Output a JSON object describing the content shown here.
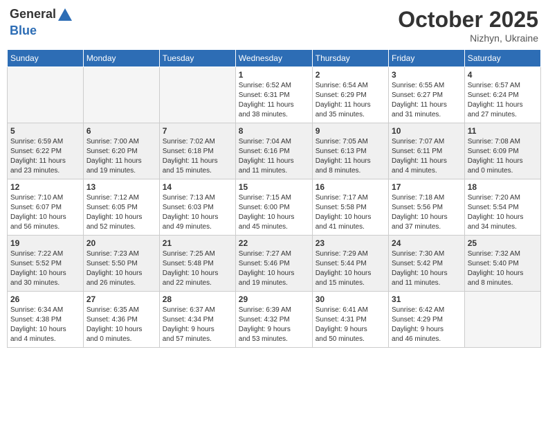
{
  "header": {
    "logo_line1": "General",
    "logo_line2": "Blue",
    "month": "October 2025",
    "location": "Nizhyn, Ukraine"
  },
  "weekdays": [
    "Sunday",
    "Monday",
    "Tuesday",
    "Wednesday",
    "Thursday",
    "Friday",
    "Saturday"
  ],
  "weeks": [
    [
      {
        "day": "",
        "info": ""
      },
      {
        "day": "",
        "info": ""
      },
      {
        "day": "",
        "info": ""
      },
      {
        "day": "1",
        "info": "Sunrise: 6:52 AM\nSunset: 6:31 PM\nDaylight: 11 hours\nand 38 minutes."
      },
      {
        "day": "2",
        "info": "Sunrise: 6:54 AM\nSunset: 6:29 PM\nDaylight: 11 hours\nand 35 minutes."
      },
      {
        "day": "3",
        "info": "Sunrise: 6:55 AM\nSunset: 6:27 PM\nDaylight: 11 hours\nand 31 minutes."
      },
      {
        "day": "4",
        "info": "Sunrise: 6:57 AM\nSunset: 6:24 PM\nDaylight: 11 hours\nand 27 minutes."
      }
    ],
    [
      {
        "day": "5",
        "info": "Sunrise: 6:59 AM\nSunset: 6:22 PM\nDaylight: 11 hours\nand 23 minutes."
      },
      {
        "day": "6",
        "info": "Sunrise: 7:00 AM\nSunset: 6:20 PM\nDaylight: 11 hours\nand 19 minutes."
      },
      {
        "day": "7",
        "info": "Sunrise: 7:02 AM\nSunset: 6:18 PM\nDaylight: 11 hours\nand 15 minutes."
      },
      {
        "day": "8",
        "info": "Sunrise: 7:04 AM\nSunset: 6:16 PM\nDaylight: 11 hours\nand 11 minutes."
      },
      {
        "day": "9",
        "info": "Sunrise: 7:05 AM\nSunset: 6:13 PM\nDaylight: 11 hours\nand 8 minutes."
      },
      {
        "day": "10",
        "info": "Sunrise: 7:07 AM\nSunset: 6:11 PM\nDaylight: 11 hours\nand 4 minutes."
      },
      {
        "day": "11",
        "info": "Sunrise: 7:08 AM\nSunset: 6:09 PM\nDaylight: 11 hours\nand 0 minutes."
      }
    ],
    [
      {
        "day": "12",
        "info": "Sunrise: 7:10 AM\nSunset: 6:07 PM\nDaylight: 10 hours\nand 56 minutes."
      },
      {
        "day": "13",
        "info": "Sunrise: 7:12 AM\nSunset: 6:05 PM\nDaylight: 10 hours\nand 52 minutes."
      },
      {
        "day": "14",
        "info": "Sunrise: 7:13 AM\nSunset: 6:03 PM\nDaylight: 10 hours\nand 49 minutes."
      },
      {
        "day": "15",
        "info": "Sunrise: 7:15 AM\nSunset: 6:00 PM\nDaylight: 10 hours\nand 45 minutes."
      },
      {
        "day": "16",
        "info": "Sunrise: 7:17 AM\nSunset: 5:58 PM\nDaylight: 10 hours\nand 41 minutes."
      },
      {
        "day": "17",
        "info": "Sunrise: 7:18 AM\nSunset: 5:56 PM\nDaylight: 10 hours\nand 37 minutes."
      },
      {
        "day": "18",
        "info": "Sunrise: 7:20 AM\nSunset: 5:54 PM\nDaylight: 10 hours\nand 34 minutes."
      }
    ],
    [
      {
        "day": "19",
        "info": "Sunrise: 7:22 AM\nSunset: 5:52 PM\nDaylight: 10 hours\nand 30 minutes."
      },
      {
        "day": "20",
        "info": "Sunrise: 7:23 AM\nSunset: 5:50 PM\nDaylight: 10 hours\nand 26 minutes."
      },
      {
        "day": "21",
        "info": "Sunrise: 7:25 AM\nSunset: 5:48 PM\nDaylight: 10 hours\nand 22 minutes."
      },
      {
        "day": "22",
        "info": "Sunrise: 7:27 AM\nSunset: 5:46 PM\nDaylight: 10 hours\nand 19 minutes."
      },
      {
        "day": "23",
        "info": "Sunrise: 7:29 AM\nSunset: 5:44 PM\nDaylight: 10 hours\nand 15 minutes."
      },
      {
        "day": "24",
        "info": "Sunrise: 7:30 AM\nSunset: 5:42 PM\nDaylight: 10 hours\nand 11 minutes."
      },
      {
        "day": "25",
        "info": "Sunrise: 7:32 AM\nSunset: 5:40 PM\nDaylight: 10 hours\nand 8 minutes."
      }
    ],
    [
      {
        "day": "26",
        "info": "Sunrise: 6:34 AM\nSunset: 4:38 PM\nDaylight: 10 hours\nand 4 minutes."
      },
      {
        "day": "27",
        "info": "Sunrise: 6:35 AM\nSunset: 4:36 PM\nDaylight: 10 hours\nand 0 minutes."
      },
      {
        "day": "28",
        "info": "Sunrise: 6:37 AM\nSunset: 4:34 PM\nDaylight: 9 hours\nand 57 minutes."
      },
      {
        "day": "29",
        "info": "Sunrise: 6:39 AM\nSunset: 4:32 PM\nDaylight: 9 hours\nand 53 minutes."
      },
      {
        "day": "30",
        "info": "Sunrise: 6:41 AM\nSunset: 4:31 PM\nDaylight: 9 hours\nand 50 minutes."
      },
      {
        "day": "31",
        "info": "Sunrise: 6:42 AM\nSunset: 4:29 PM\nDaylight: 9 hours\nand 46 minutes."
      },
      {
        "day": "",
        "info": ""
      }
    ]
  ]
}
